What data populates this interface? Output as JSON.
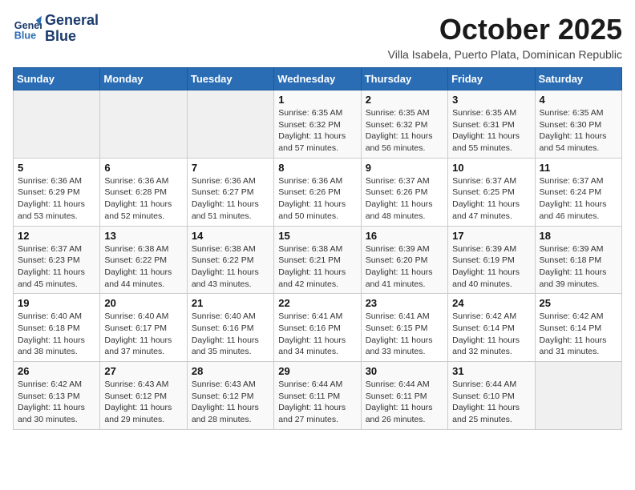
{
  "header": {
    "logo_line1": "General",
    "logo_line2": "Blue",
    "month": "October 2025",
    "location": "Villa Isabela, Puerto Plata, Dominican Republic"
  },
  "weekdays": [
    "Sunday",
    "Monday",
    "Tuesday",
    "Wednesday",
    "Thursday",
    "Friday",
    "Saturday"
  ],
  "weeks": [
    [
      {
        "day": "",
        "info": ""
      },
      {
        "day": "",
        "info": ""
      },
      {
        "day": "",
        "info": ""
      },
      {
        "day": "1",
        "info": "Sunrise: 6:35 AM\nSunset: 6:32 PM\nDaylight: 11 hours\nand 57 minutes."
      },
      {
        "day": "2",
        "info": "Sunrise: 6:35 AM\nSunset: 6:32 PM\nDaylight: 11 hours\nand 56 minutes."
      },
      {
        "day": "3",
        "info": "Sunrise: 6:35 AM\nSunset: 6:31 PM\nDaylight: 11 hours\nand 55 minutes."
      },
      {
        "day": "4",
        "info": "Sunrise: 6:35 AM\nSunset: 6:30 PM\nDaylight: 11 hours\nand 54 minutes."
      }
    ],
    [
      {
        "day": "5",
        "info": "Sunrise: 6:36 AM\nSunset: 6:29 PM\nDaylight: 11 hours\nand 53 minutes."
      },
      {
        "day": "6",
        "info": "Sunrise: 6:36 AM\nSunset: 6:28 PM\nDaylight: 11 hours\nand 52 minutes."
      },
      {
        "day": "7",
        "info": "Sunrise: 6:36 AM\nSunset: 6:27 PM\nDaylight: 11 hours\nand 51 minutes."
      },
      {
        "day": "8",
        "info": "Sunrise: 6:36 AM\nSunset: 6:26 PM\nDaylight: 11 hours\nand 50 minutes."
      },
      {
        "day": "9",
        "info": "Sunrise: 6:37 AM\nSunset: 6:26 PM\nDaylight: 11 hours\nand 48 minutes."
      },
      {
        "day": "10",
        "info": "Sunrise: 6:37 AM\nSunset: 6:25 PM\nDaylight: 11 hours\nand 47 minutes."
      },
      {
        "day": "11",
        "info": "Sunrise: 6:37 AM\nSunset: 6:24 PM\nDaylight: 11 hours\nand 46 minutes."
      }
    ],
    [
      {
        "day": "12",
        "info": "Sunrise: 6:37 AM\nSunset: 6:23 PM\nDaylight: 11 hours\nand 45 minutes."
      },
      {
        "day": "13",
        "info": "Sunrise: 6:38 AM\nSunset: 6:22 PM\nDaylight: 11 hours\nand 44 minutes."
      },
      {
        "day": "14",
        "info": "Sunrise: 6:38 AM\nSunset: 6:22 PM\nDaylight: 11 hours\nand 43 minutes."
      },
      {
        "day": "15",
        "info": "Sunrise: 6:38 AM\nSunset: 6:21 PM\nDaylight: 11 hours\nand 42 minutes."
      },
      {
        "day": "16",
        "info": "Sunrise: 6:39 AM\nSunset: 6:20 PM\nDaylight: 11 hours\nand 41 minutes."
      },
      {
        "day": "17",
        "info": "Sunrise: 6:39 AM\nSunset: 6:19 PM\nDaylight: 11 hours\nand 40 minutes."
      },
      {
        "day": "18",
        "info": "Sunrise: 6:39 AM\nSunset: 6:18 PM\nDaylight: 11 hours\nand 39 minutes."
      }
    ],
    [
      {
        "day": "19",
        "info": "Sunrise: 6:40 AM\nSunset: 6:18 PM\nDaylight: 11 hours\nand 38 minutes."
      },
      {
        "day": "20",
        "info": "Sunrise: 6:40 AM\nSunset: 6:17 PM\nDaylight: 11 hours\nand 37 minutes."
      },
      {
        "day": "21",
        "info": "Sunrise: 6:40 AM\nSunset: 6:16 PM\nDaylight: 11 hours\nand 35 minutes."
      },
      {
        "day": "22",
        "info": "Sunrise: 6:41 AM\nSunset: 6:16 PM\nDaylight: 11 hours\nand 34 minutes."
      },
      {
        "day": "23",
        "info": "Sunrise: 6:41 AM\nSunset: 6:15 PM\nDaylight: 11 hours\nand 33 minutes."
      },
      {
        "day": "24",
        "info": "Sunrise: 6:42 AM\nSunset: 6:14 PM\nDaylight: 11 hours\nand 32 minutes."
      },
      {
        "day": "25",
        "info": "Sunrise: 6:42 AM\nSunset: 6:14 PM\nDaylight: 11 hours\nand 31 minutes."
      }
    ],
    [
      {
        "day": "26",
        "info": "Sunrise: 6:42 AM\nSunset: 6:13 PM\nDaylight: 11 hours\nand 30 minutes."
      },
      {
        "day": "27",
        "info": "Sunrise: 6:43 AM\nSunset: 6:12 PM\nDaylight: 11 hours\nand 29 minutes."
      },
      {
        "day": "28",
        "info": "Sunrise: 6:43 AM\nSunset: 6:12 PM\nDaylight: 11 hours\nand 28 minutes."
      },
      {
        "day": "29",
        "info": "Sunrise: 6:44 AM\nSunset: 6:11 PM\nDaylight: 11 hours\nand 27 minutes."
      },
      {
        "day": "30",
        "info": "Sunrise: 6:44 AM\nSunset: 6:11 PM\nDaylight: 11 hours\nand 26 minutes."
      },
      {
        "day": "31",
        "info": "Sunrise: 6:44 AM\nSunset: 6:10 PM\nDaylight: 11 hours\nand 25 minutes."
      },
      {
        "day": "",
        "info": ""
      }
    ]
  ]
}
